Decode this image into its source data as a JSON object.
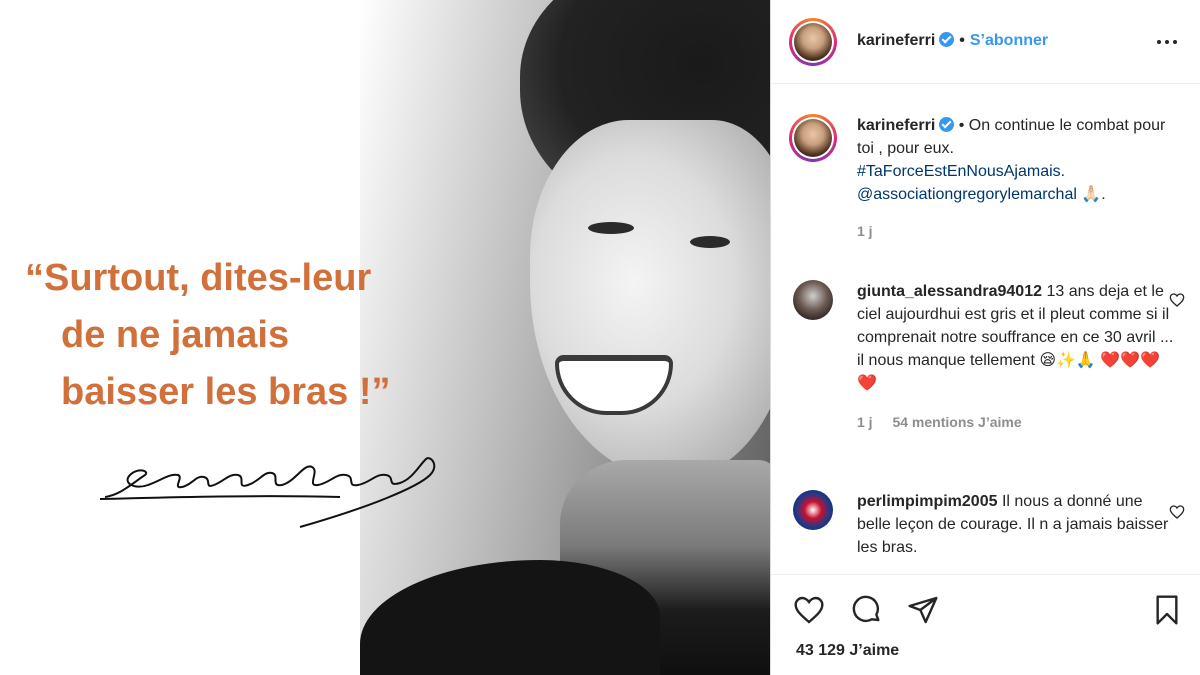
{
  "image": {
    "quote_lines": [
      "“Surtout, dites-leur",
      "de ne jamais",
      "baisser les bras !”"
    ],
    "signature_text": "Gregory Lemarchal",
    "quote_color": "#d1703a"
  },
  "header": {
    "username": "karineferri",
    "separator": "•",
    "follow_label": "S’abonner",
    "more_icon": "more-horizontal-icon"
  },
  "caption": {
    "username": "karineferri",
    "text_lead": "• On continue le combat pour toi , pour eux.",
    "hashtag": "#TaForceEstEnNousAjamais.",
    "mention": "@associationgregorylemarchal",
    "trail": " 🙏🏻.",
    "time": "1 j"
  },
  "comments": [
    {
      "username": "giunta_alessandra94012",
      "text": "13 ans deja et le ciel aujourdhui est gris et il pleut comme si il comprenait notre souffrance en ce 30 avril ... il nous manque tellement 😪✨🙏 ❤️❤️❤️❤️",
      "time": "1 j",
      "likes": "54 mentions J’aime"
    },
    {
      "username": "perlimpimpim2005",
      "text": "Il nous a donné une belle leçon de courage. Il n a jamais baisser les bras."
    }
  ],
  "actions": {
    "like_icon": "heart-icon",
    "comment_icon": "comment-icon",
    "share_icon": "share-icon",
    "save_icon": "bookmark-icon",
    "likes_count": "43 129 J’aime"
  },
  "colors": {
    "link_blue": "#3897f0",
    "hashtag_blue": "#00376b",
    "muted": "#8e8e8e",
    "text": "#262626"
  }
}
